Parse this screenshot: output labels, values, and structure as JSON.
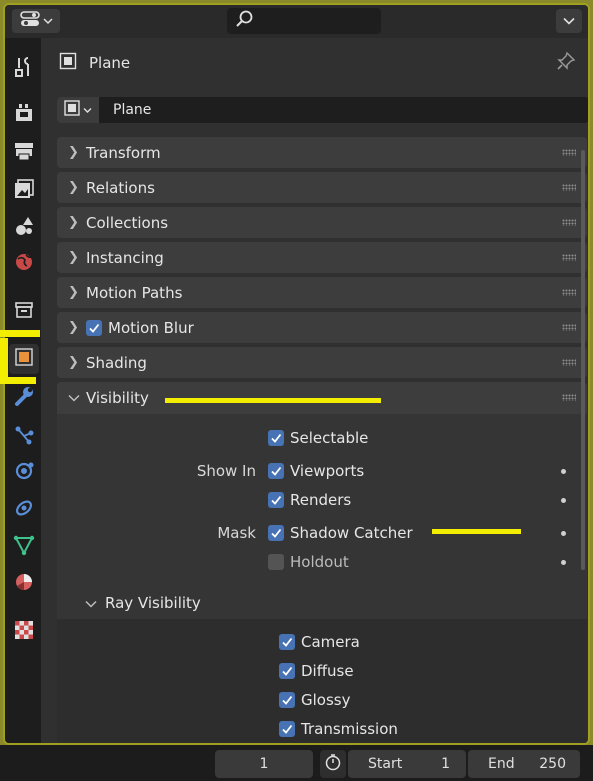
{
  "header": {
    "editor_type_icon": "properties-editor-icon",
    "search_placeholder": "",
    "menu_icon": "chevron-down-icon"
  },
  "tabs": [
    {
      "name": "tool-icon",
      "active": false
    },
    {
      "name": "render-icon",
      "active": false
    },
    {
      "name": "output-icon",
      "active": false
    },
    {
      "name": "view-layer-icon",
      "active": false
    },
    {
      "name": "scene-icon",
      "active": false
    },
    {
      "name": "world-icon",
      "active": false
    },
    {
      "name": "collection-icon",
      "active": false
    },
    {
      "name": "object-icon",
      "active": true
    },
    {
      "name": "modifier-wrench-icon",
      "active": false
    },
    {
      "name": "particles-icon",
      "active": false
    },
    {
      "name": "physics-icon",
      "active": false
    },
    {
      "name": "constraints-icon",
      "active": false
    },
    {
      "name": "object-data-icon",
      "active": false
    },
    {
      "name": "material-icon",
      "active": false
    },
    {
      "name": "texture-icon",
      "active": false
    }
  ],
  "context": {
    "title": "Plane",
    "object_name": "Plane"
  },
  "panels": {
    "transform": "Transform",
    "relations": "Relations",
    "collections": "Collections",
    "instancing": "Instancing",
    "motion_paths": "Motion Paths",
    "motion_blur": "Motion Blur",
    "shading": "Shading",
    "visibility": "Visibility"
  },
  "visibility": {
    "selectable": {
      "label": "Selectable",
      "checked": true
    },
    "show_in_label": "Show In",
    "viewports": {
      "label": "Viewports",
      "checked": true
    },
    "renders": {
      "label": "Renders",
      "checked": true
    },
    "mask_label": "Mask",
    "shadow_catcher": {
      "label": "Shadow Catcher",
      "checked": true
    },
    "holdout": {
      "label": "Holdout",
      "checked": false
    }
  },
  "ray_visibility": {
    "title": "Ray Visibility",
    "camera": {
      "label": "Camera",
      "checked": true
    },
    "diffuse": {
      "label": "Diffuse",
      "checked": true
    },
    "glossy": {
      "label": "Glossy",
      "checked": true
    },
    "transmission": {
      "label": "Transmission",
      "checked": true
    }
  },
  "footer": {
    "current_frame": "1",
    "start_label": "Start",
    "start_value": "1",
    "end_label": "End",
    "end_value": "250"
  },
  "colors": {
    "accent": "#4772b3",
    "object_orange": "#e8923c",
    "highlight": "#f3ee00"
  }
}
